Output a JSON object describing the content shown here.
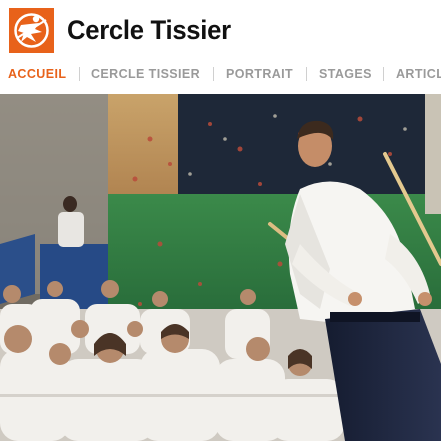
{
  "site": {
    "title": "Cercle Tissier",
    "logo_icon": "aikido-figure-icon",
    "brand_color": "#e8621a"
  },
  "nav": {
    "items": [
      {
        "label": "ACCUEIL",
        "active": true
      },
      {
        "label": "CERCLE TISSIER",
        "active": false
      },
      {
        "label": "PORTRAIT",
        "active": false
      },
      {
        "label": "STAGES",
        "active": false
      },
      {
        "label": "ARTICLES",
        "active": false
      }
    ]
  },
  "hero": {
    "image_icon": "aikido-demonstration-photo"
  }
}
